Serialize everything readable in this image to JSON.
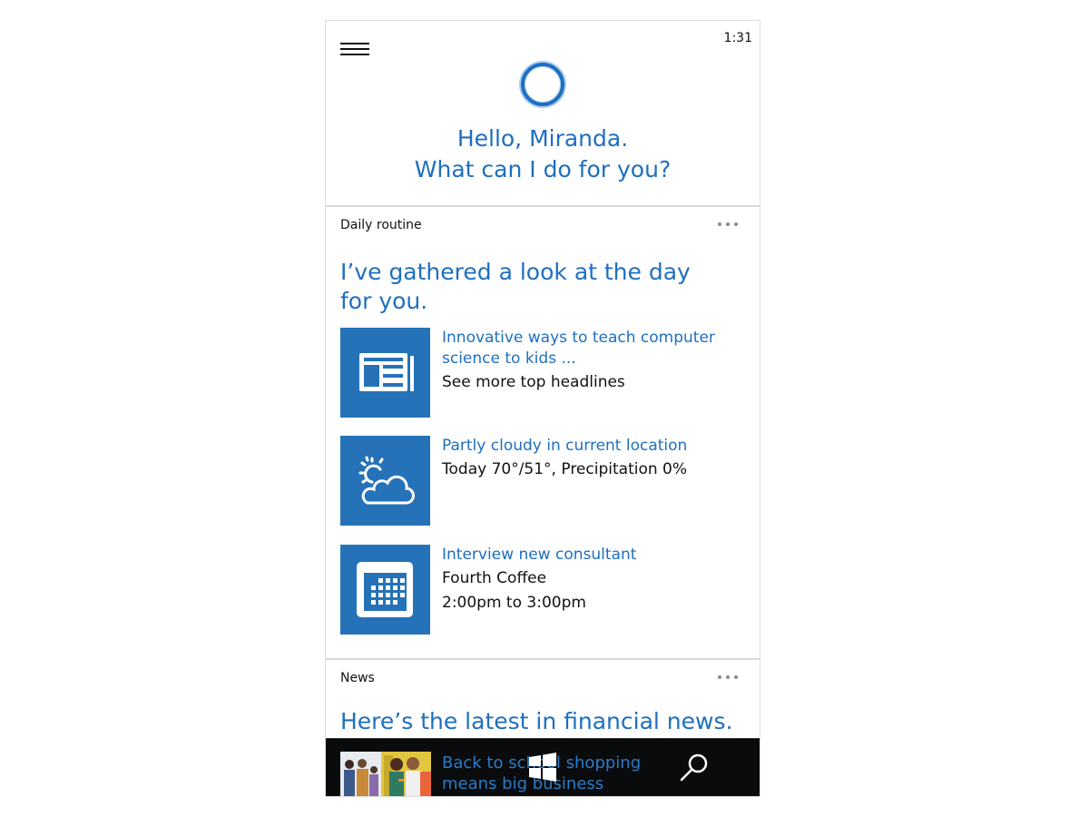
{
  "status": {
    "time": "1:31"
  },
  "header": {
    "menu_icon": "hamburger-icon",
    "assistant_icon": "cortana-ring-icon",
    "greeting_line1": "Hello, Miranda.",
    "greeting_line2": "What can I do for you?"
  },
  "daily_routine": {
    "title": "Daily routine",
    "more_icon": "ellipsis-icon",
    "headline": "I’ve gathered a look at the day for you.",
    "items": [
      {
        "icon": "newspaper-icon",
        "link": "Innovative ways to teach computer science to kids ...",
        "lines": [
          "See more top headlines"
        ]
      },
      {
        "icon": "partly-cloudy-icon",
        "link": "Partly cloudy in current location",
        "lines": [
          "Today 70°/51°, Precipitation 0%"
        ]
      },
      {
        "icon": "calendar-icon",
        "link": "Interview new consultant",
        "lines": [
          "Fourth Coffee",
          "2:00pm to 3:00pm"
        ]
      }
    ]
  },
  "news": {
    "title": "News",
    "more_icon": "ellipsis-icon",
    "headline": "Here’s the latest in financial news."
  },
  "taskbar": {
    "thumbnail": "news-photo-thumbnail",
    "article_title": "Back to school shopping means big business",
    "start_icon": "windows-logo-icon",
    "search_icon": "search-icon"
  },
  "colors": {
    "accent": "#1e6fbf",
    "tile": "#2672b8",
    "taskbar": "#0a0b0d"
  }
}
